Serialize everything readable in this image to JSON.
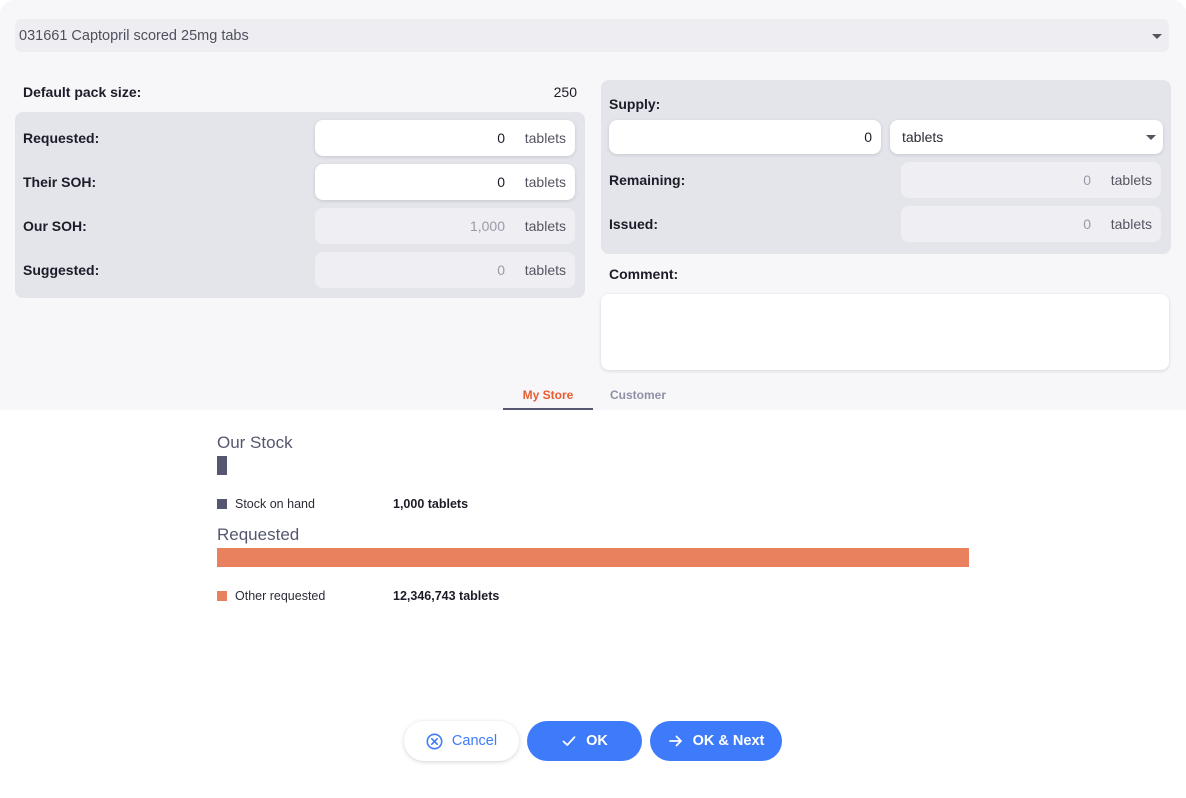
{
  "item": {
    "selected": "031661 Captopril scored 25mg tabs"
  },
  "pack": {
    "label": "Default pack size:",
    "value": "250"
  },
  "left_fields": [
    {
      "label": "Requested:",
      "value": "0",
      "unit": "tablets"
    },
    {
      "label": "Their SOH:",
      "value": "0",
      "unit": "tablets"
    },
    {
      "label": "Our SOH:",
      "value": "1,000",
      "unit": "tablets"
    },
    {
      "label": "Suggested:",
      "value": "0",
      "unit": "tablets"
    }
  ],
  "supply": {
    "label": "Supply:",
    "value": "0",
    "unit_selected": "tablets"
  },
  "right_fields": [
    {
      "label": "Remaining:",
      "value": "0",
      "unit": "tablets"
    },
    {
      "label": "Issued:",
      "value": "0",
      "unit": "tablets"
    }
  ],
  "comment": {
    "label": "Comment:",
    "value": ""
  },
  "tabs": [
    {
      "label": "My Store"
    },
    {
      "label": "Customer"
    }
  ],
  "our_stock": {
    "title": "Our Stock",
    "legend_label": "Stock on hand",
    "legend_value": "1,000 tablets"
  },
  "requested": {
    "title": "Requested",
    "legend_label": "Other requested",
    "legend_value": "12,346,743 tablets"
  },
  "chart_data": {
    "type": "bar",
    "series": [
      {
        "name": "Stock on hand",
        "values": [
          1000
        ],
        "color": "#555770"
      },
      {
        "name": "Other requested",
        "values": [
          12346743
        ],
        "color": "#e9805e"
      }
    ],
    "unit": "tablets"
  },
  "buttons": {
    "cancel": "Cancel",
    "ok": "OK",
    "ok_next": "OK & Next"
  },
  "colors": {
    "accent": "#3e7bfa",
    "tab_active": "#e95c30",
    "stock_bar": "#555770",
    "requested_bar": "#e9805e"
  }
}
